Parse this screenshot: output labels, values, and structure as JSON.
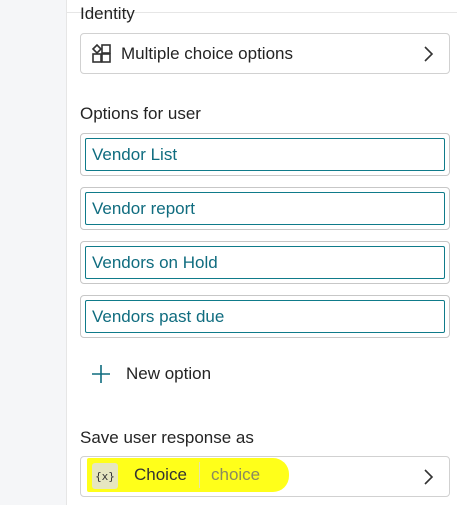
{
  "identity": {
    "heading": "Identity",
    "value": "Multiple choice options",
    "icon": "multiple-choice-icon"
  },
  "options": {
    "heading": "Options for user",
    "items": [
      {
        "label": "Vendor List"
      },
      {
        "label": "Vendor report"
      },
      {
        "label": "Vendors on Hold"
      },
      {
        "label": "Vendors past due"
      }
    ],
    "new_option_label": "New option"
  },
  "save": {
    "heading": "Save user response as",
    "variable_badge": "{x}",
    "variable_name": "Choice",
    "variable_type": "choice",
    "highlight_color": "#ffff1a"
  },
  "colors": {
    "accent": "#0f6c7f",
    "border": "#d1d1d1"
  }
}
